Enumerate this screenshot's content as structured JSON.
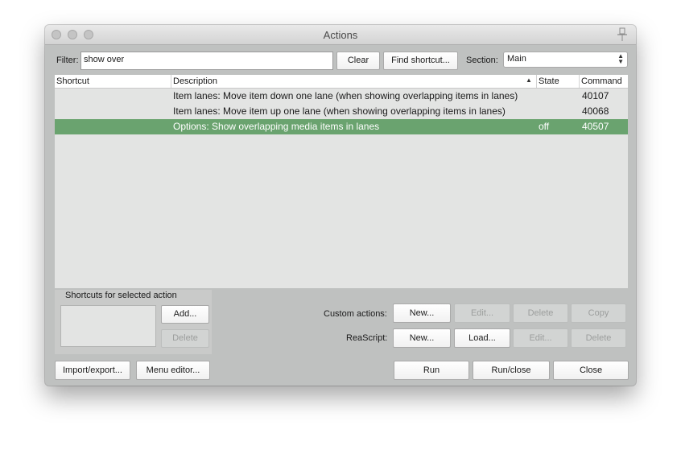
{
  "window": {
    "title": "Actions"
  },
  "filter": {
    "label": "Filter:",
    "value": "show over"
  },
  "buttons": {
    "clear": "Clear",
    "find_shortcut": "Find shortcut...",
    "add": "Add...",
    "delete_shortcut": "Delete",
    "custom_new": "New...",
    "custom_edit": "Edit...",
    "custom_delete": "Delete",
    "custom_copy": "Copy",
    "reascript_new": "New...",
    "reascript_load": "Load...",
    "reascript_edit": "Edit...",
    "reascript_delete": "Delete",
    "import_export": "Import/export...",
    "menu_editor": "Menu editor...",
    "run": "Run",
    "run_close": "Run/close",
    "close": "Close"
  },
  "section": {
    "label": "Section:",
    "value": "Main"
  },
  "columns": {
    "shortcut": "Shortcut",
    "description": "Description",
    "state": "State",
    "command": "Command"
  },
  "rows": [
    {
      "shortcut": "",
      "description": "Item lanes: Move item down one lane (when showing overlapping items in lanes)",
      "state": "",
      "command": "40107",
      "selected": false
    },
    {
      "shortcut": "",
      "description": "Item lanes: Move item up one lane (when showing overlapping items in lanes)",
      "state": "",
      "command": "40068",
      "selected": false
    },
    {
      "shortcut": "",
      "description": "Options: Show overlapping media items in lanes",
      "state": "off",
      "command": "40507",
      "selected": true
    }
  ],
  "shortcuts_group": {
    "title": "Shortcuts for selected action"
  },
  "custom_actions": {
    "label": "Custom actions:"
  },
  "reascript": {
    "label": "ReaScript:"
  },
  "colors": {
    "selection": "#6aa36f",
    "window_bg": "#bfc1c0",
    "list_bg": "#e3e4e3"
  }
}
